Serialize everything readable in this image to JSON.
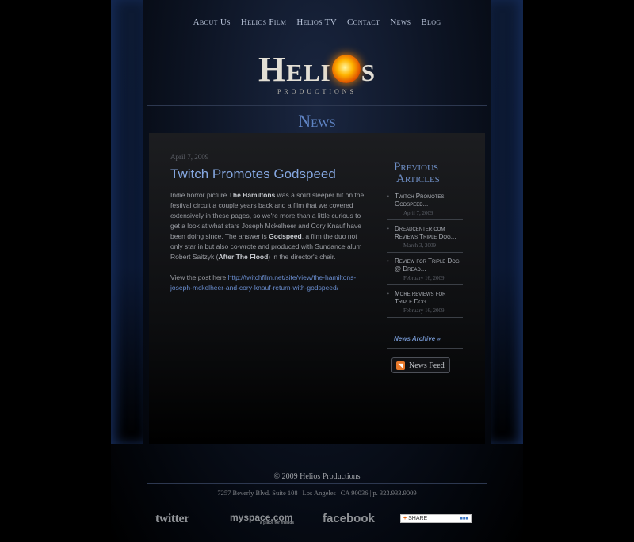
{
  "nav": {
    "items": [
      "About Us",
      "Helios Film",
      "Helios TV",
      "Contact",
      "News",
      "Blog"
    ]
  },
  "logo": {
    "word_start": "Heli",
    "word_end": "s",
    "subtitle": "Productions"
  },
  "section": {
    "title": "News"
  },
  "post": {
    "date": "April 7, 2009",
    "title": "Twitch Promotes Godspeed",
    "p1_a": "Indie horror picture ",
    "p1_b": "The Hamiltons",
    "p1_c": " was a solid sleeper hit on the festival circuit a couple years back and a film that we covered extensively in these pages, so we're more than a little curious to get a look at what stars Joseph Mckelheer and Cory Knauf have been doing since.  The answer is ",
    "p1_d": "Godspeed",
    "p1_e": ", a film the duo not only star in but also co-wrote and produced with Sundance alum Robert Saitzyk (",
    "p1_f": "After The Flood",
    "p1_g": ") in the director's chair.",
    "p2_a": "View the post here ",
    "p2_link": "http://twitchfilm.net/site/view/the-hamiltons-joseph-mckelheer-and-cory-knauf-return-with-godspeed/"
  },
  "sidebar": {
    "title_line1": "Previous",
    "title_line2": "Articles",
    "articles": [
      {
        "title": "Twitch Promotes Godspeed...",
        "date": "April 7, 2009"
      },
      {
        "title": "Dreadcenter.com Reviews Triple Dog...",
        "date": "March 3, 2009"
      },
      {
        "title": "Review for Triple Dog @ Dread...",
        "date": "February 16, 2009"
      },
      {
        "title": "More reviews for Triple Dog...",
        "date": "February 16, 2009"
      }
    ],
    "archive": "News Archive »",
    "feed": "News Feed"
  },
  "footer": {
    "copyright": "© 2009 Helios Productions",
    "address": "7257 Beverly Blvd. Suite 108 | Los Angeles | CA 90036 | p. 323.933.9009",
    "twitter": "twitter",
    "myspace": "myspace.com",
    "myspace_sub": "a place for friends",
    "facebook": "facebook",
    "share": "SHARE"
  }
}
